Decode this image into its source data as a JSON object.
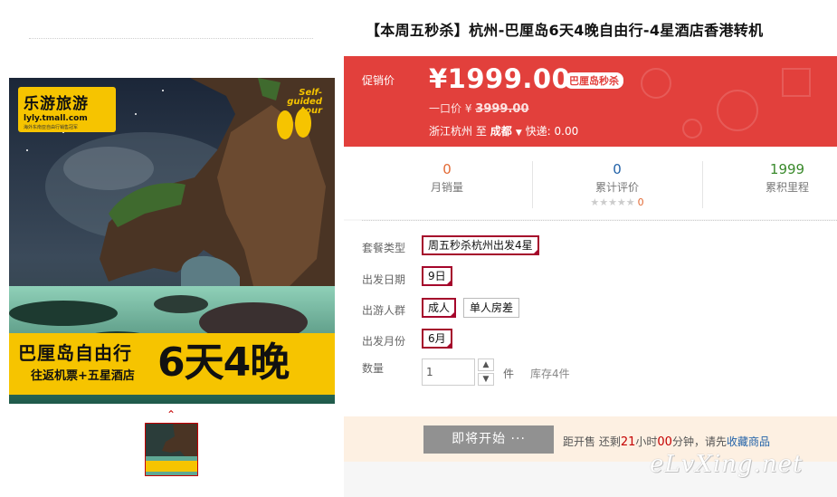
{
  "gallery": {
    "brand_name": "乐游旅游",
    "brand_url": "lyly.tmall.com",
    "brand_tagline": "海外东南亚自由行销售冠军",
    "badge_text": "Self-guided tour",
    "banner_title": "巴厘岛自由行",
    "banner_sub": "往返机票+五星酒店",
    "banner_days": "6天4晚"
  },
  "product": {
    "title": "【本周五秒杀】杭州-巴厘岛6天4晚自由行-4星酒店香港转机"
  },
  "price": {
    "label": "促销价",
    "value": "¥1999.00",
    "badge": "巴厘岛秒杀",
    "orig_label": "一口价 ¥",
    "orig_value": "3999.00",
    "from": "浙江杭州",
    "to_word": "至",
    "destination": "成都",
    "shipping": "快递: 0.00"
  },
  "stats": {
    "monthly_sales": {
      "value": "0",
      "label": "月销量"
    },
    "reviews": {
      "value": "0",
      "label": "累计评价",
      "stars": "★★★★★",
      "count": "0"
    },
    "mileage": {
      "value": "1999",
      "label": "累积里程"
    }
  },
  "options": {
    "package_label": "套餐类型",
    "package_value": "周五秒杀杭州出发4星",
    "date_label": "出发日期",
    "date_value": "9日",
    "group_label": "出游人群",
    "group_values": [
      "成人",
      "单人房差"
    ],
    "month_label": "出发月份",
    "month_value": "6月",
    "qty_label": "数量",
    "qty_value": "1",
    "qty_unit": "件",
    "stock": "库存4件"
  },
  "buy": {
    "button": "即将开始 ···",
    "cd_prefix": "距开售 还剩",
    "cd_hours": "21",
    "cd_h_unit": "小时",
    "cd_mins": "00",
    "cd_m_unit": "分钟，请先",
    "cd_fav": "收藏商品"
  },
  "watermark": "eLvXing.net",
  "colors": {
    "price_bg": "#e2403c",
    "accent_red": "#a5062b",
    "stat_orange": "#e26a35",
    "stat_green": "#3a8a2c",
    "brand_yellow": "#f6c400"
  }
}
